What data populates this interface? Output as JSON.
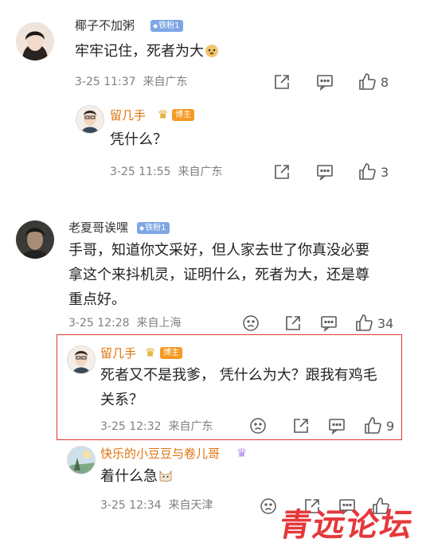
{
  "comments": [
    {
      "username": "椰子不加粥",
      "badge": "铁粉1",
      "text": "牢牢记住，死者为大",
      "time": "3-25 11:37",
      "location": "来自广东",
      "likes": "8",
      "reply": {
        "username": "留几手",
        "badge": "博主",
        "text": "凭什么？",
        "time": "3-25 11:55",
        "location": "来自广东",
        "likes": "3"
      }
    },
    {
      "username": "老夏哥诶嘿",
      "badge": "铁粉1",
      "text_lines": [
        "手哥，知道你文采好，但人家去世了你真没必要",
        "拿这个来抖机灵，证明什么，死者为大，还是尊",
        "重点好。"
      ],
      "time": "3-25 12:28",
      "location": "来自上海",
      "likes": "34",
      "replies": [
        {
          "username": "留几手",
          "badge": "博主",
          "text_lines": [
            "死者又不是我爹， 凭什么为大？跟我有鸡毛",
            "关系？"
          ],
          "time": "3-25 12:32",
          "location": "来自广东",
          "likes": "9"
        },
        {
          "username": "快乐的小豆豆与卷儿哥",
          "text": "着什么急",
          "time": "3-25 12:34",
          "location": "来自天津"
        }
      ]
    }
  ],
  "watermark": "青远论坛",
  "colors": {
    "accent_orange": "#e0730d",
    "highlight_red": "#e23434",
    "fan_badge": "#7fa6e6"
  }
}
